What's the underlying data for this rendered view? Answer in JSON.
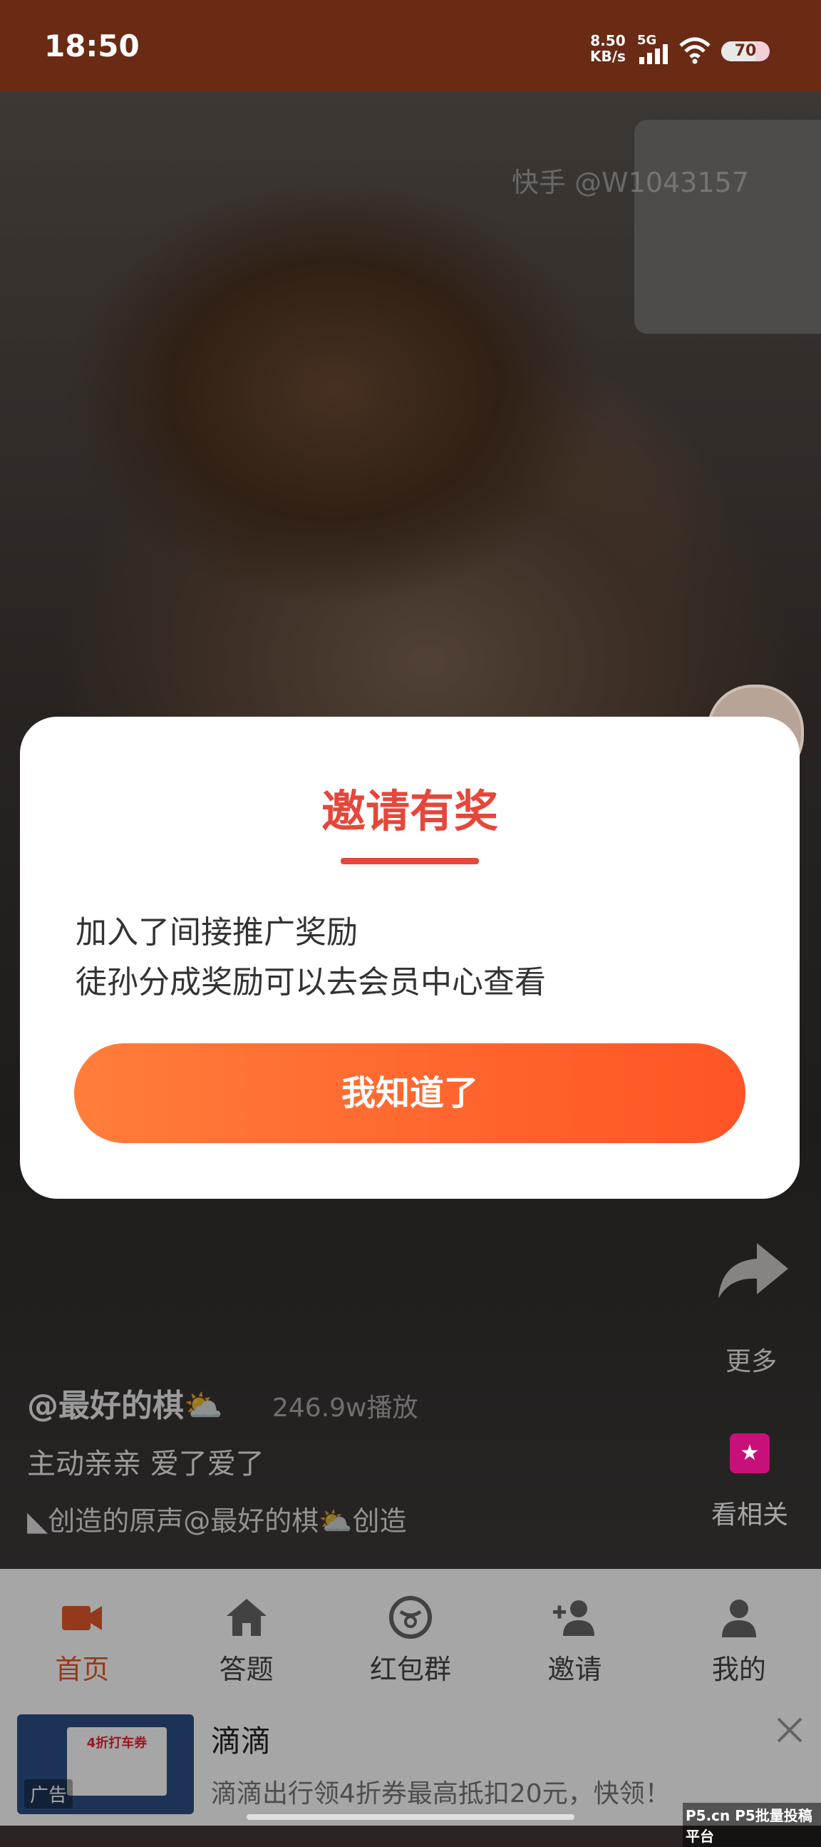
{
  "status_bar": {
    "time": "18:50",
    "net_speed": "8.50",
    "net_unit": "KB/s",
    "signal_type": "5G",
    "battery": "70"
  },
  "video": {
    "watermark": "快手 @W1043157",
    "author": "@最好的棋⛅",
    "plays": "246.9w播放",
    "caption": "主动亲亲 爱了爱了",
    "music": "创造的原声@最好的棋⛅创造",
    "side": {
      "more_label": "更多",
      "related_label": "看相关"
    }
  },
  "modal": {
    "title": "邀请有奖",
    "message_line1": "加入了间接推广奖励",
    "message_line2": "徒孙分成奖励可以去会员中心查看",
    "confirm_button": "我知道了",
    "accent_color": "#e5473b"
  },
  "bottom_nav": {
    "items": [
      {
        "label": "首页",
        "icon": "video-camera-icon",
        "active": true
      },
      {
        "label": "答题",
        "icon": "home-icon",
        "active": false
      },
      {
        "label": "红包群",
        "icon": "red-envelope-icon",
        "active": false
      },
      {
        "label": "邀请",
        "icon": "add-user-icon",
        "active": false
      },
      {
        "label": "我的",
        "icon": "user-icon",
        "active": false
      }
    ]
  },
  "ad": {
    "title": "滴滴",
    "description": "滴滴出行领4折券最高抵扣20元，快领！",
    "tag": "广告",
    "thumb_text": "4折打车券"
  },
  "corner_watermark": "P5.cn P5批量投稿平台"
}
